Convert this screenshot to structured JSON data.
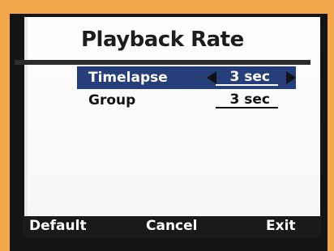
{
  "title": "Playback Rate",
  "rows": [
    {
      "label": "Timelapse",
      "value": "3 sec",
      "selected": true
    },
    {
      "label": "Group",
      "value": "3 sec",
      "selected": false
    }
  ],
  "softkeys": {
    "left": "Default",
    "center": "Cancel",
    "right": "Exit"
  },
  "colors": {
    "highlight": "#263f7a",
    "bezel": "#141414",
    "background": "#f4a64a"
  },
  "icons": {
    "left": "triangle-left",
    "right": "triangle-right"
  }
}
